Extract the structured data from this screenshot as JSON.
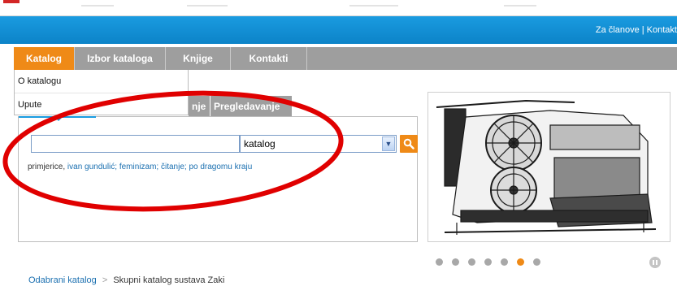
{
  "header": {
    "utility_links": "Za članove | Kontakt"
  },
  "nav": {
    "tabs": [
      {
        "label": "Katalog",
        "active": true
      },
      {
        "label": "Izbor kataloga",
        "active": false
      },
      {
        "label": "Knjige",
        "active": false
      },
      {
        "label": "Kontakti",
        "active": false
      }
    ],
    "dropdown": [
      "O katalogu",
      "Upute"
    ]
  },
  "search": {
    "subtabs": [
      "nje",
      "Pregledavanje"
    ],
    "query_value": "",
    "catalog_select": "katalog",
    "examples_label": "primjerice,",
    "examples": [
      "ivan gundulić;",
      "feminizam;",
      "čitanje;",
      "po dragomu kraju"
    ]
  },
  "slider": {
    "dot_count": 7,
    "active_index": 5
  },
  "breadcrumb": {
    "link": "Odabrani katalog",
    "separator": ">",
    "current": "Skupni katalog sustava Zaki"
  },
  "colors": {
    "accent_orange": "#ef8a17",
    "header_blue": "#1a9be0",
    "nav_gray": "#9e9e9e",
    "annotation_red": "#e00000"
  }
}
